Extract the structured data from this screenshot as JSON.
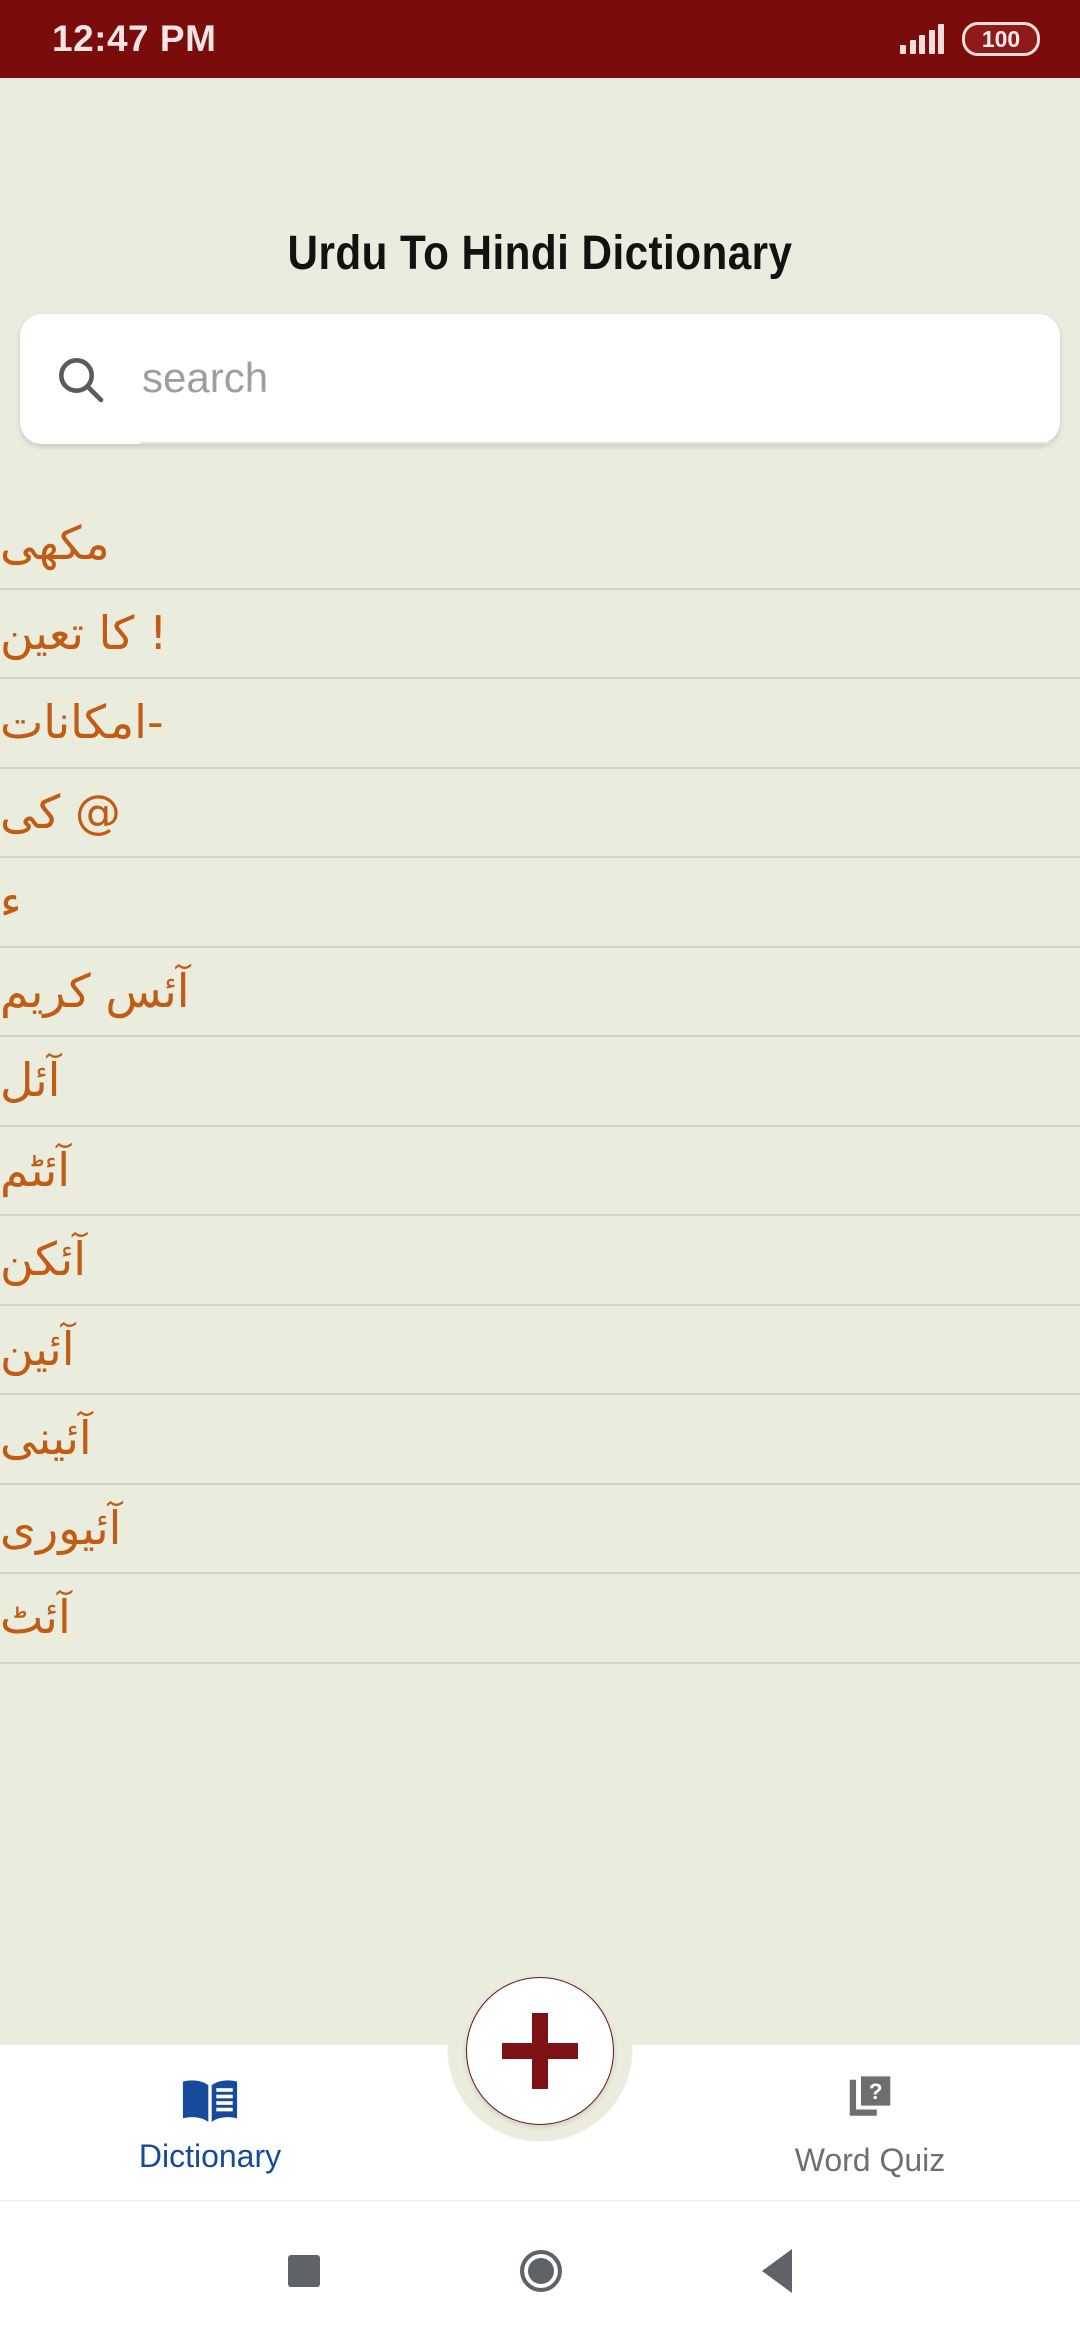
{
  "status_bar": {
    "time": "12:47 PM",
    "battery_level": "100",
    "signal_icon": "signal-bars-icon",
    "background_color": "#7A0C0C"
  },
  "header": {
    "title": "Urdu To Hindi Dictionary"
  },
  "search": {
    "placeholder": "search",
    "value": "",
    "icon": "search-icon"
  },
  "word_list": {
    "items": [
      {
        "word": "مکھی"
      },
      {
        "word": "! کا تعین"
      },
      {
        "word": "-امکانات"
      },
      {
        "word": "@ کی"
      },
      {
        "word": "ء"
      },
      {
        "word": "آئس کریم"
      },
      {
        "word": "آئل"
      },
      {
        "word": "آئٹم"
      },
      {
        "word": "آئکن"
      },
      {
        "word": "آئین"
      },
      {
        "word": "آئینی"
      },
      {
        "word": "آئیوری"
      },
      {
        "word": "آئٹ"
      }
    ],
    "text_color": "#C25B14",
    "divider_color": "#CFD4BF"
  },
  "fab": {
    "label": "+",
    "icon": "plus-icon",
    "color": "#7E1113"
  },
  "bottom_nav": {
    "items": [
      {
        "label": "Dictionary",
        "icon": "open-book-icon",
        "active": true,
        "color": "#17499C"
      },
      {
        "label": "Word Quiz",
        "icon": "quiz-card-icon",
        "active": false,
        "color": "#6E6E6E"
      }
    ]
  },
  "android_nav": {
    "recents_icon": "square-recents-icon",
    "home_icon": "circle-home-icon",
    "back_icon": "triangle-back-icon"
  }
}
